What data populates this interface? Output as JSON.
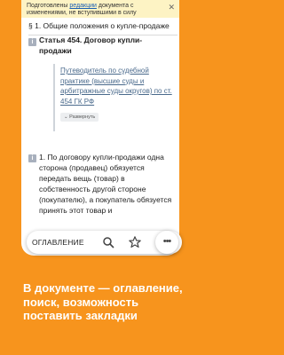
{
  "notice": {
    "text_before": "Подготовлены ",
    "link": "редакции",
    "text_after": " документа с изменениями, не вступившими в силу",
    "close": "✕"
  },
  "document": {
    "section_heading": "§ 1. Общие положения о купле-продаже",
    "article_title": "Статья 454. Договор купли-продажи",
    "practice_link": "Путеводитель по судебной практике (высшие суды и арбитражные суды округов) по ст. 454 ГК РФ",
    "expand_label": "⌄ Развернуть",
    "paragraph": "1. По договору купли-продажи одна сторона (продавец) обязуется передать вещь (товар) в собственность другой стороне (покупателю), а покупатель обязуется принять этот товар и"
  },
  "toolbar": {
    "toc_label": "ОГЛАВЛЕНИЕ",
    "icons": [
      "search-icon",
      "star-icon",
      "more-icon"
    ],
    "more_label": "•••"
  },
  "caption": "В документе — оглавление, поиск, возможность поставить закладки",
  "colors": {
    "background": "#f7941d",
    "notice": "#fdf3c4",
    "link": "#1a5fb4"
  }
}
